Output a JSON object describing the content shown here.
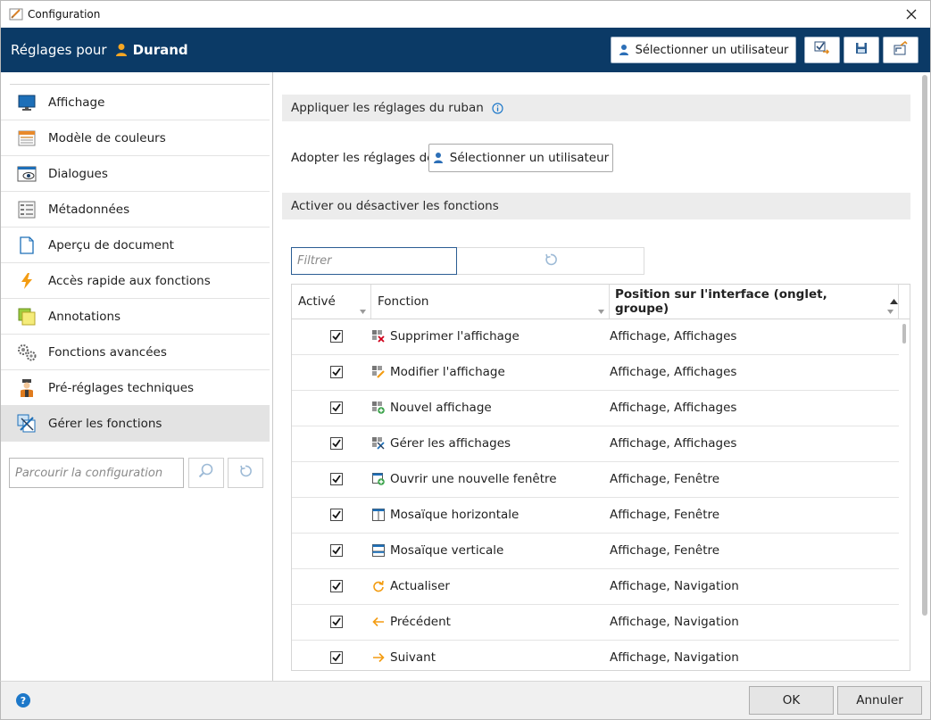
{
  "window": {
    "title": "Configuration"
  },
  "header": {
    "label": "Réglages pour",
    "user_name": "Durand",
    "select_user_label": "Sélectionner un utilisateur"
  },
  "sidebar": {
    "items": [
      {
        "label": "Affichage",
        "icon": "monitor-icon"
      },
      {
        "label": "Modèle de couleurs",
        "icon": "color-model-icon"
      },
      {
        "label": "Dialogues",
        "icon": "dialog-eye-icon"
      },
      {
        "label": "Métadonnées",
        "icon": "metadata-list-icon"
      },
      {
        "label": "Aperçu de document",
        "icon": "document-preview-icon"
      },
      {
        "label": "Accès rapide aux fonctions",
        "icon": "lightning-icon"
      },
      {
        "label": "Annotations",
        "icon": "sticky-note-icon"
      },
      {
        "label": "Fonctions avancées",
        "icon": "gears-icon"
      },
      {
        "label": "Pré-réglages techniques",
        "icon": "technician-icon"
      },
      {
        "label": "Gérer les fonctions",
        "icon": "manage-functions-icon",
        "active": true
      }
    ],
    "search_placeholder": "Parcourir la configuration"
  },
  "main": {
    "section1_title": "Appliquer les réglages du ruban",
    "adopt_label": "Adopter les réglages de",
    "adopt_button_label": "Sélectionner un utilisateur",
    "section2_title": "Activer ou désactiver les fonctions",
    "filter_placeholder": "Filtrer",
    "columns": {
      "active": "Activé",
      "function": "Fonction",
      "position": "Position sur l'interface (onglet, groupe)"
    },
    "rows": [
      {
        "checked": true,
        "icon": "remove-view-icon",
        "name": "Supprimer l'affichage",
        "position": "Affichage, Affichages"
      },
      {
        "checked": true,
        "icon": "edit-view-icon",
        "name": "Modifier l'affichage",
        "position": "Affichage, Affichages"
      },
      {
        "checked": true,
        "icon": "new-view-icon",
        "name": "Nouvel affichage",
        "position": "Affichage, Affichages"
      },
      {
        "checked": true,
        "icon": "manage-views-icon",
        "name": "Gérer les affichages",
        "position": "Affichage, Affichages"
      },
      {
        "checked": true,
        "icon": "new-window-icon",
        "name": "Ouvrir une nouvelle fenêtre",
        "position": "Affichage, Fenêtre"
      },
      {
        "checked": true,
        "icon": "tile-horizontal-icon",
        "name": "Mosaïque horizontale",
        "position": "Affichage, Fenêtre"
      },
      {
        "checked": true,
        "icon": "tile-vertical-icon",
        "name": "Mosaïque verticale",
        "position": "Affichage, Fenêtre"
      },
      {
        "checked": true,
        "icon": "refresh-icon",
        "name": "Actualiser",
        "position": "Affichage, Navigation"
      },
      {
        "checked": true,
        "icon": "arrow-left-icon",
        "name": "Précédent",
        "position": "Affichage, Navigation"
      },
      {
        "checked": true,
        "icon": "arrow-right-icon",
        "name": "Suivant",
        "position": "Affichage, Navigation"
      }
    ]
  },
  "footer": {
    "help_label": "?",
    "ok_label": "OK",
    "cancel_label": "Annuler"
  },
  "colors": {
    "header_bg": "#0b3a66",
    "accent_blue": "#1d78c9",
    "user_icon": "#f5a623",
    "active_nav_bg": "#e3e3e3"
  }
}
